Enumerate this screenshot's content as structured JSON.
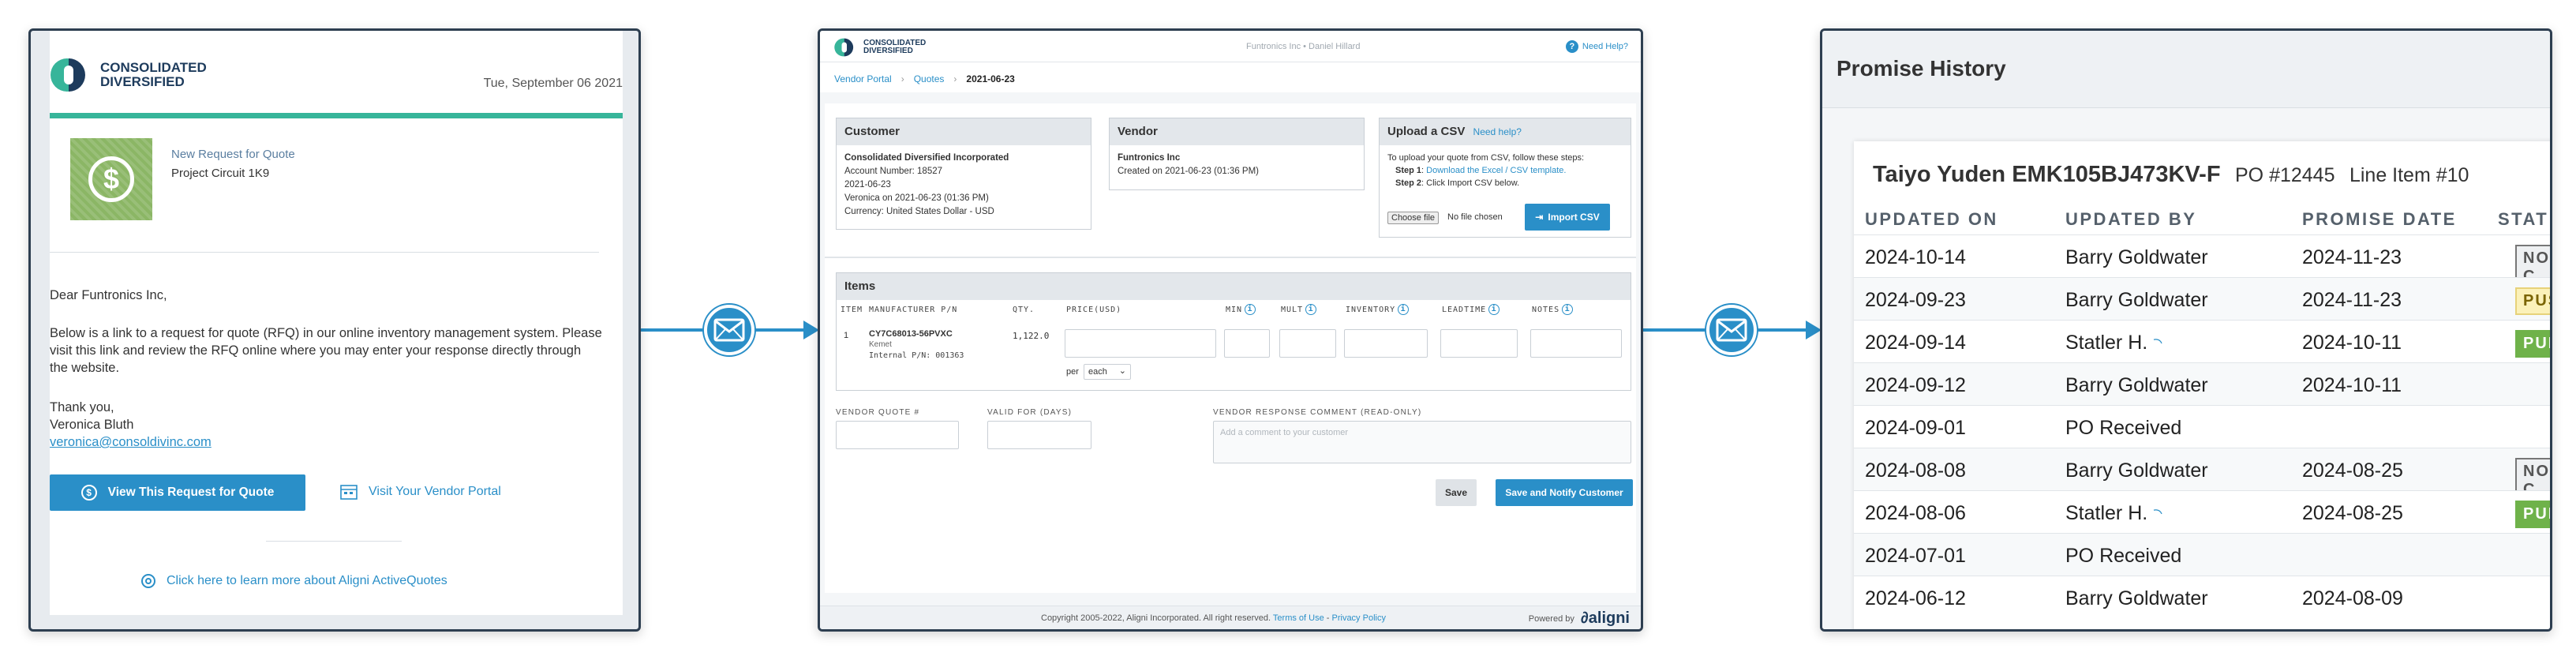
{
  "colors": {
    "accent": "#2a8fc8",
    "teal": "#37b59a",
    "navy": "#1d3b5c",
    "frame": "#2d3e50"
  },
  "email": {
    "logo_line1": "CONSOLIDATED",
    "logo_line2": "DIVERSIFIED",
    "date": "Tue, September 06 2021",
    "rfq_heading": "New Request for Quote",
    "project": "Project Circuit 1K9",
    "greeting": "Dear Funtronics Inc,",
    "body": "Below is a link to a request for quote (RFQ) in our online inventory management system. Please visit this link and review the RFQ online where you may enter your response directly through the website.",
    "thanks": "Thank you,",
    "signer": "Veronica Bluth",
    "signer_email": "veronica@consoldivinc.com",
    "view_button": "View This Request for Quote",
    "portal_link": "Visit Your Vendor Portal",
    "learn_link": "Click here to learn more about Aligni ActiveQuotes"
  },
  "portal": {
    "logo_line1": "CONSOLIDATED",
    "logo_line2": "DIVERSIFIED",
    "user_info": "Funtronics Inc • Daniel Hillard",
    "need_help": "Need Help?",
    "breadcrumb": [
      "Vendor Portal",
      "Quotes",
      "2021-06-23"
    ],
    "customer": {
      "title": "Customer",
      "name": "Consolidated Diversified Incorporated",
      "account": "Account Number: 18527",
      "date": "2021-06-23",
      "by": "Veronica on 2021-06-23 (01:36 PM)",
      "currency": "Currency: United States Dollar - USD"
    },
    "vendor": {
      "title": "Vendor",
      "name": "Funtronics Inc",
      "created": "Created on 2021-06-23 (01:36 PM)"
    },
    "upload": {
      "title": "Upload a CSV",
      "help": "Need help?",
      "intro": "To upload your quote from CSV, follow these steps:",
      "step1_label": "Step 1",
      "step1_text": "Download the Excel / CSV template.",
      "step2_label": "Step 2",
      "step2_text": "Click Import CSV below.",
      "choose_file": "Choose file",
      "no_file": "No file chosen",
      "import_button": "Import CSV"
    },
    "items": {
      "title": "Items",
      "columns": [
        "ITEM",
        "MANUFACTURER P/N",
        "QTY.",
        "PRICE(USD)",
        "MIN",
        "MULT",
        "INVENTORY",
        "LEADTIME",
        "NOTES"
      ],
      "row": {
        "item": "1",
        "mpn": "CY7C68013-56PVXC",
        "maker": "Kemet",
        "internal": "Internal P/N: 001363",
        "qty": "1,122.0",
        "per_label": "per",
        "unit": "each"
      }
    },
    "vendor_quote_label": "VENDOR QUOTE #",
    "valid_for_label": "VALID FOR (DAYS)",
    "comment_label": "VENDOR RESPONSE COMMENT (READ-ONLY)",
    "comment_placeholder": "Add a comment to your customer",
    "save_button": "Save",
    "save_notify_button": "Save and Notify Customer",
    "footer": "Copyright 2005-2022, Aligni Incorporated. All right reserved.",
    "terms": "Terms of Use",
    "privacy": "Privacy Policy",
    "powered": "Powered by",
    "brand": "aligni"
  },
  "history": {
    "title": "Promise History",
    "part": "Taiyo Yuden EMK105BJ473KV-F",
    "po": "PO #12445",
    "line": "Line Item #10",
    "headers": [
      "UPDATED ON",
      "UPDATED BY",
      "PROMISE DATE",
      "STAT"
    ],
    "rows": [
      {
        "on": "2024-10-14",
        "by": "Barry Goldwater",
        "promise": "2024-11-23",
        "status": "NO C",
        "kind": "gray",
        "icon": false
      },
      {
        "on": "2024-09-23",
        "by": "Barry Goldwater",
        "promise": "2024-11-23",
        "status": "PUS",
        "kind": "yellow",
        "icon": false
      },
      {
        "on": "2024-09-14",
        "by": "Statler H.",
        "promise": "2024-10-11",
        "status": "PUL",
        "kind": "green",
        "icon": true
      },
      {
        "on": "2024-09-12",
        "by": "Barry Goldwater",
        "promise": "2024-10-11",
        "status": "",
        "kind": "",
        "icon": false
      },
      {
        "on": "2024-09-01",
        "by": "PO Received",
        "promise": "",
        "status": "",
        "kind": "",
        "icon": false
      },
      {
        "on": "2024-08-08",
        "by": "Barry Goldwater",
        "promise": "2024-08-25",
        "status": "NO C",
        "kind": "gray",
        "icon": false
      },
      {
        "on": "2024-08-06",
        "by": "Statler H.",
        "promise": "2024-08-25",
        "status": "PUL",
        "kind": "green",
        "icon": true
      },
      {
        "on": "2024-07-01",
        "by": "PO Received",
        "promise": "",
        "status": "",
        "kind": "",
        "icon": false
      },
      {
        "on": "2024-06-12",
        "by": "Barry Goldwater",
        "promise": "2024-08-09",
        "status": "",
        "kind": "",
        "icon": false
      }
    ]
  }
}
